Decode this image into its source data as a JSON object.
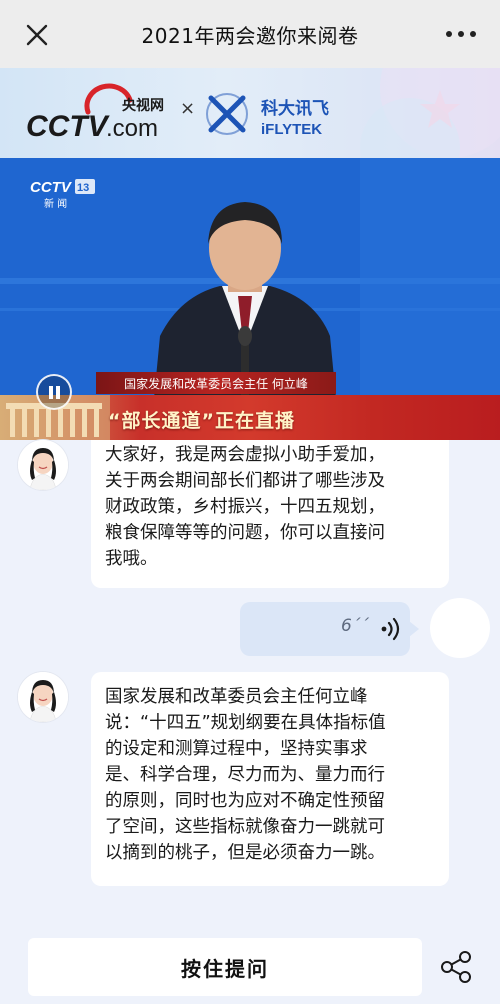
{
  "navbar": {
    "title": "2021年两会邀你来阅卷",
    "close_icon": "close-icon",
    "more_icon": "more-dots-icon"
  },
  "brand": {
    "cctv_logo_text": "CCTV.com",
    "cctv_cn": "央视网",
    "separator": "×",
    "ifly_cn": "科大讯飞",
    "ifly_en": "iFLYTEK"
  },
  "video": {
    "channel_logo": "CCTV 13 新闻",
    "caption": "国家发展和改革委员会主任 何立峰",
    "live_text": "“部长通道”正在直播",
    "state": "playing"
  },
  "chat": {
    "messages": [
      {
        "from": "assistant",
        "lines": [
          "大家好，我是两会虚拟小助手爱加，",
          "关于两会期间部长们都讲了哪些涉及",
          "财政政策，乡村振兴，十四五规划，",
          "粮食保障等等的问题，你可以直接问",
          "我哦。"
        ]
      },
      {
        "from": "user",
        "type": "voice",
        "duration": "6´´"
      },
      {
        "from": "assistant",
        "lines": [
          "国家发展和改革委员会主任何立峰",
          "说：“十四五”规划纲要在具体指标值",
          "的设定和测算过程中，坚持实事求",
          "是、科学合理，尽力而为、量力而行",
          "的原则，同时也为应对不确定性预留",
          "了空间，这些指标就像奋力一跳就可",
          "以摘到的桃子，但是必须奋力一跳。"
        ]
      }
    ]
  },
  "bottom": {
    "ask_label": "按住提问",
    "share_icon": "share-icon"
  },
  "colors": {
    "nav_bg": "#ededed",
    "chat_bg": "#eef2fb",
    "video_blue": "#1f63cc",
    "live_red": "#c8302a",
    "voice_bubble": "#dbe6f7",
    "cctv_red": "#d8242a",
    "ifly_blue": "#1d54b6"
  }
}
